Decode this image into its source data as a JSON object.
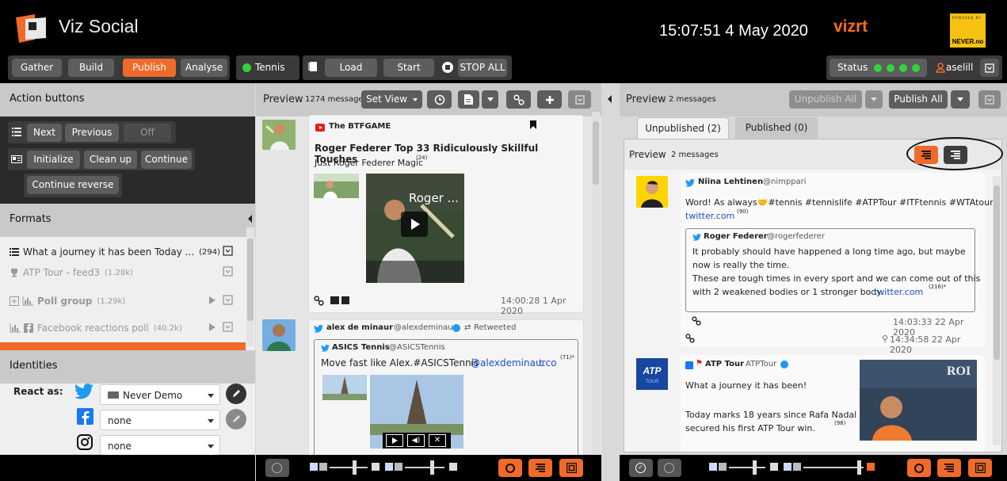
{
  "header": {
    "app_title": "Viz Social",
    "clock": "15:07:51 4 May 2020",
    "vizrt_logo": "vizrt",
    "never_powered": "POWERED BY",
    "never_logo": "NEVER.no",
    "tabs": [
      {
        "label": "Gather"
      },
      {
        "label": "Build"
      },
      {
        "label": "Publish"
      },
      {
        "label": "Analyse"
      }
    ],
    "active_tab": "Publish",
    "topic": "Tennis",
    "load_label": "Load",
    "start_label": "Start",
    "stop_all_label": "STOP ALL",
    "status_label": "Status",
    "user": "aselill"
  },
  "left": {
    "action_buttons_title": "Action buttons",
    "next_label": "Next",
    "previous_label": "Previous",
    "off_label": "Off",
    "initialize_label": "Initialize",
    "cleanup_label": "Clean up",
    "continue_label": "Continue",
    "continue_reverse_label": "Continue reverse",
    "formats_title": "Formats",
    "formats": [
      {
        "name": "What a journey it has been Today ...",
        "count": "(294)"
      },
      {
        "name": "ATP Tour - feed3",
        "count": "(1.28k)"
      },
      {
        "name": "Poll group",
        "count": "(1.29k)"
      },
      {
        "name": "Facebook reactions poll",
        "count": "(40.2k)"
      }
    ],
    "identities_title": "Identities",
    "react_as_label": "React as:",
    "twitter_identity": "Never Demo",
    "facebook_identity": "none",
    "instagram_identity": "none"
  },
  "middle": {
    "preview_label": "Preview",
    "message_count": "1274 messages",
    "set_view_label": "Set View",
    "posts": [
      {
        "source": "The BTFGAME",
        "title": "Roger Federer Top 33 Ridiculously Skillful Touches",
        "text": "Just Roger Federer Magic",
        "count": "(24)",
        "video_title": "Roger ...",
        "timestamp": "14:00:28 1 Apr 2020"
      },
      {
        "author": "alex de minaur",
        "handle": "@alexdeminaur",
        "retweeted": "Retweeted",
        "quoted_author": "ASICS Tennis",
        "quoted_handle": "@ASICSTennis",
        "quoted_text": "Move fast like Alex.#ASICSTennis",
        "quoted_mention": "@alexdeminaur",
        "quoted_link": "t.co",
        "quoted_count": "(71)*"
      }
    ]
  },
  "right": {
    "preview_label": "Preview",
    "message_count": "2 messages",
    "unpublish_all_label": "Unpublish All",
    "publish_all_label": "Publish All",
    "tabs": [
      {
        "label": "Unpublished (2)"
      },
      {
        "label": "Published (0)"
      }
    ],
    "sub_preview_label": "Preview",
    "sub_message_count": "2 messages",
    "posts": [
      {
        "author": "Niina Lehtinen",
        "handle": "@nimppari",
        "text": "Word! As always🤝#tennis #tennislife #ATPTour #ITFtennis #WTAtour",
        "link": "twitter.com",
        "count": "(90)",
        "quoted_author": "Roger Federer",
        "quoted_handle": "@rogerfederer",
        "quoted_line1": "It probably should have happened a long time ago, but maybe",
        "quoted_line2": "now is really the time.",
        "quoted_line3": "These are tough times in every sport and we can come out of this",
        "quoted_line4": "with 2 weakened bodies or 1 stronger body.",
        "quoted_link": "twitter.com",
        "quoted_count": "(216)*",
        "quoted_time": "14:03:33 22 Apr 2020",
        "timestamp": "14:34:58 22 Apr 2020"
      },
      {
        "author": "ATP Tour",
        "handle": "ATPTour",
        "text1": "What a journey it has been!",
        "text2": "Today marks 18 years since Rafa Nadal",
        "text3": "secured his first ATP Tour win.",
        "count": "(98)",
        "thumb_text": "ROI"
      }
    ]
  },
  "colors": {
    "accent": "#f06a2a",
    "status_green": "#36d13b",
    "twitter": "#1d9bf0",
    "link": "#1b4fcf"
  }
}
